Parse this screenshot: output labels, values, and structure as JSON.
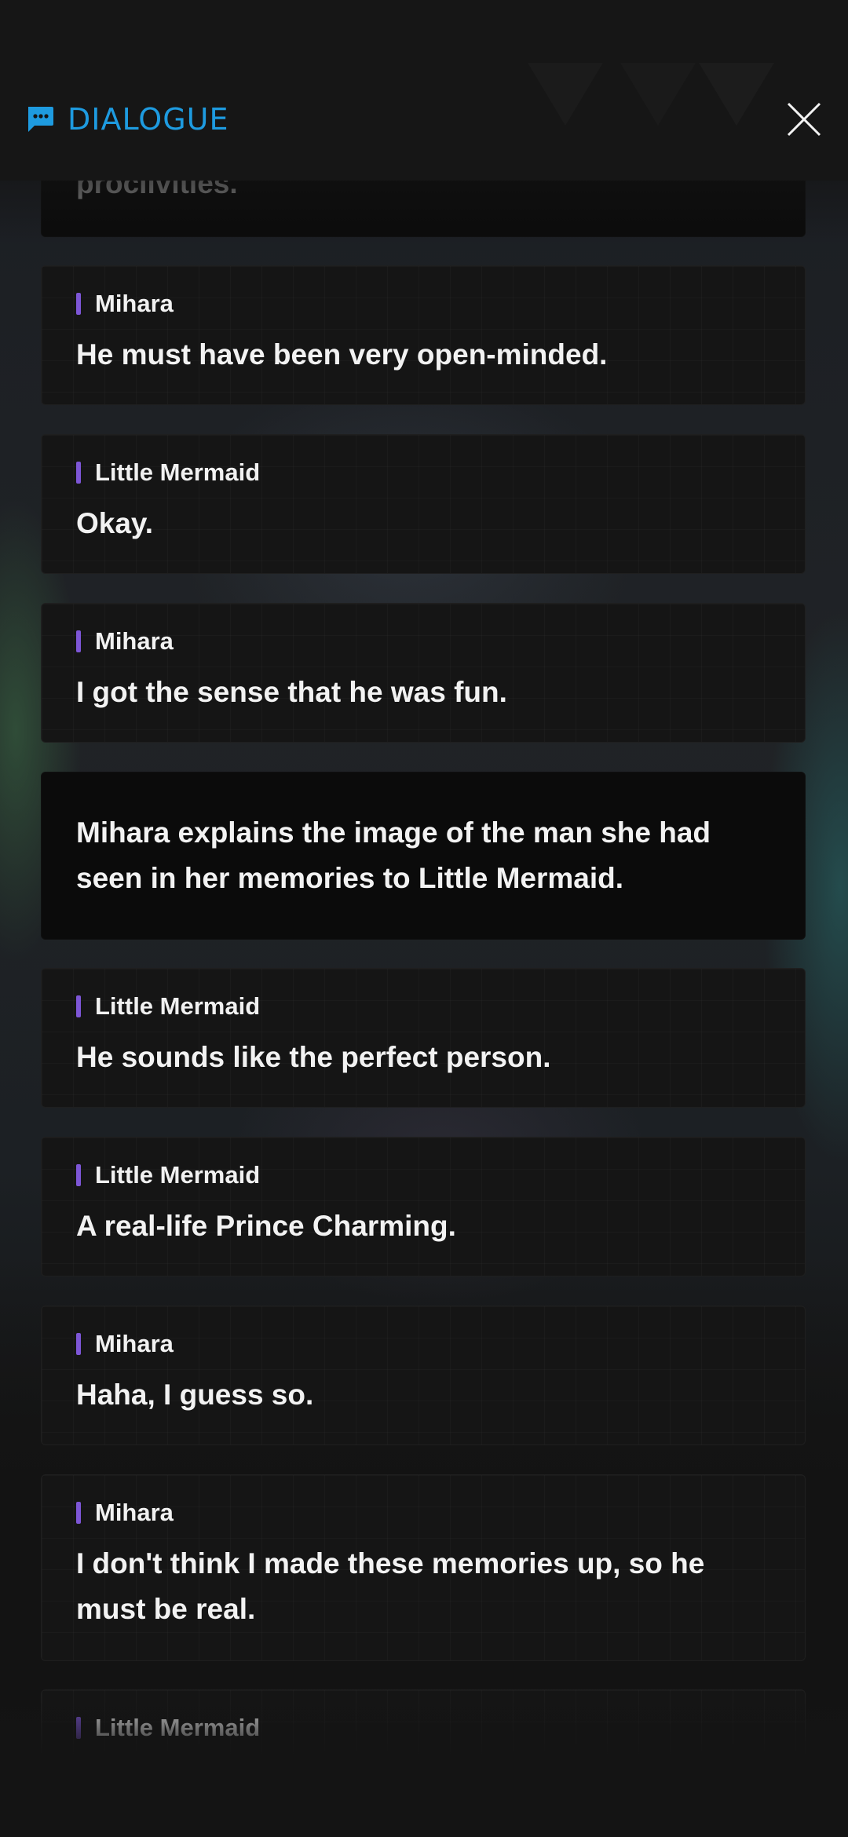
{
  "header": {
    "title": "DIALOGUE",
    "title_icon": "chat-bubble-icon",
    "close_icon": "close-icon",
    "accent_color": "#1e9be0"
  },
  "dialogue": [
    {
      "type": "narration",
      "text": "proclivities."
    },
    {
      "type": "line",
      "speaker": "Mihara",
      "text": "He must have been very open-minded."
    },
    {
      "type": "line",
      "speaker": "Little Mermaid",
      "text": "Okay."
    },
    {
      "type": "line",
      "speaker": "Mihara",
      "text": "I got the sense that he was fun."
    },
    {
      "type": "narration",
      "text": "Mihara explains the image of the man she had seen in her memories to Little Mermaid."
    },
    {
      "type": "line",
      "speaker": "Little Mermaid",
      "text": "He sounds like the perfect person."
    },
    {
      "type": "line",
      "speaker": "Little Mermaid",
      "text": "A real-life Prince Charming."
    },
    {
      "type": "line",
      "speaker": "Mihara",
      "text": "Haha, I guess so."
    },
    {
      "type": "line",
      "speaker": "Mihara",
      "text": "I don't think I made these memories up, so he must be real."
    },
    {
      "type": "line",
      "speaker": "Little Mermaid",
      "text": ""
    }
  ],
  "colors": {
    "speaker_bar": "#7d56d6",
    "card_bg": "#151515",
    "narration_bg": "#0b0b0b"
  }
}
